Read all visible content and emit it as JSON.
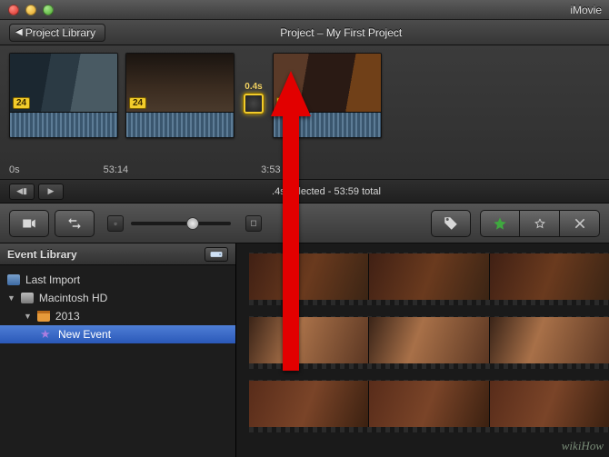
{
  "app_title": "iMovie",
  "watermark": "wikiHow",
  "header": {
    "project_library_label": "Project Library",
    "project_title": "Project – My First Project"
  },
  "timeline": {
    "clips": [
      {
        "badge": "24"
      },
      {
        "badge": "24"
      },
      {
        "badge": "24"
      }
    ],
    "gap_duration": "0.4s",
    "timecodes": [
      "0s",
      "53:14",
      "3:53"
    ]
  },
  "midbar": {
    "selection_info": ".4s selected - 53:59 total"
  },
  "event_library": {
    "title": "Event Library",
    "items": {
      "last_import": "Last Import",
      "drive": "Macintosh HD",
      "year": "2013",
      "event": "New Event"
    }
  }
}
